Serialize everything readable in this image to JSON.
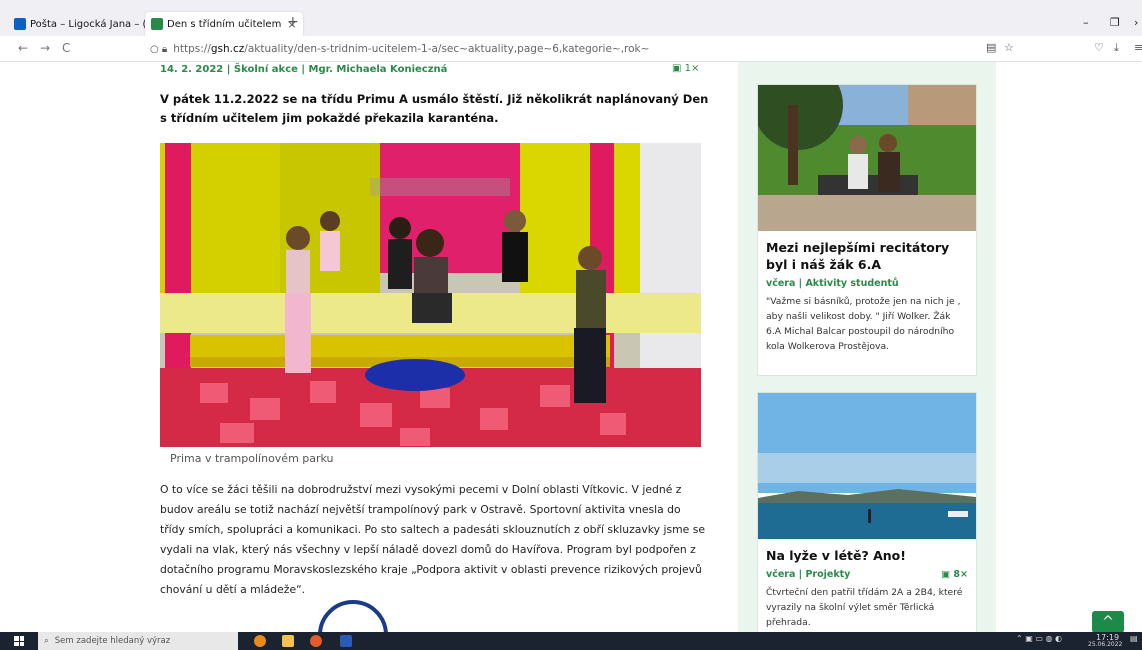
{
  "browser": {
    "tabs": [
      {
        "label": "Pošta – Ligocká Jana – (",
        "close": "×",
        "favicon_color": "#0b62c4"
      },
      {
        "label": "Den s třídním učitelem",
        "close": "×",
        "favicon_color": "#2a8a4a"
      }
    ],
    "new_tab": "+",
    "window_controls": {
      "minimize": "–",
      "restore": "❐",
      "close": "›"
    },
    "nav": {
      "back": "←",
      "forward": "→",
      "reload": "C"
    },
    "url_prefix": "https://",
    "url_domain": "gsh.cz",
    "url_path": "/aktuality/den-s-tridnim-ucitelem-1-a/sec~aktuality,page~6,kategorie~,rok~",
    "toolbar_icons": [
      "reader-icon",
      "bookmark-star-icon",
      "pocket-icon",
      "download-icon",
      "menu-icon"
    ]
  },
  "article": {
    "meta": "14. 2. 2022 | Školní akce | Mgr. Michaela Konieczná",
    "gallery_count": "1×",
    "lead": "V pátek 11.2.2022 se na třídu Primu A usmálo štěstí. Již několikrát naplánovaný Den s třídním učitelem jim pokaždé překazila karanténa.",
    "caption": "Prima v trampolínovém parku",
    "body": "O to více se žáci těšili na dobrodružství mezi vysokými pecemi v Dolní oblasti Vítkovic. V jedné z budov areálu se totiž nachází největší trampolínový park v Ostravě. Sportovní aktivita vnesla do třídy smích, spolupráci a komunikaci. Po sto saltech a padesáti sklouznutích z obří skluzavky jsme se vydali na vlak, který nás všechny v lepší náladě dovezl domů do Havířova. Program byl podpořen z dotačního programu Moravskoslezského kraje „Podpora aktivit v oblasti prevence rizikových projevů chování u dětí a mládeže“."
  },
  "sidebar": {
    "cards": [
      {
        "title": "Mezi nejlepšími recitátory byl i náš žák 6.A",
        "meta": "včera | Aktivity studentů",
        "gallery_count": "",
        "desc": "\"Važme si básníků, protože jen na nich je , aby našli velikost doby. \" Jiří Wolker. Žák 6.A Michal Balcar postoupil do národního kola Wolkerova Prostějova."
      },
      {
        "title": "Na lyže v létě? Ano!",
        "meta": "včera | Projekty",
        "gallery_count": "8×",
        "desc": "Čtvrteční den patřil třídám 2A a 2B4, které vyrazily na školní výlet směr Těrlická přehrada."
      }
    ]
  },
  "scroll_top": "^",
  "taskbar": {
    "search_placeholder": "Sem zadejte hledaný výraz",
    "time": "17:19",
    "date": "25.06.2022"
  },
  "colors": {
    "accent_green": "#2a8a4a",
    "sidebar_bg": "#eaf5ee",
    "taskbar": "#1b2330"
  }
}
